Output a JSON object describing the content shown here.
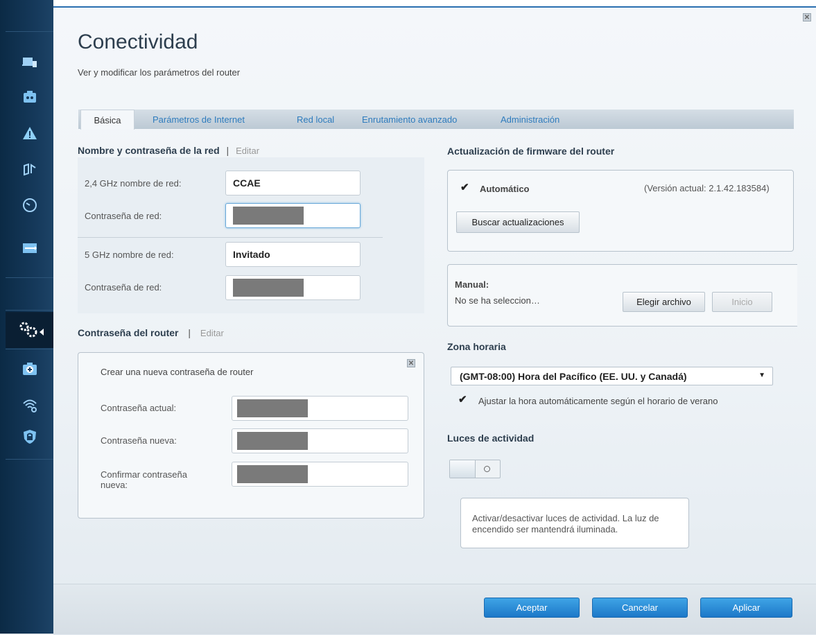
{
  "sidebar": {
    "icons": [
      "devices-icon",
      "parental-controls-icon",
      "warning-icon",
      "media-priority-icon",
      "speed-test-icon",
      "usb-storage-icon",
      "connectivity-icon",
      "troubleshooting-icon",
      "wireless-icon",
      "security-icon"
    ]
  },
  "header": {
    "title": "Conectividad",
    "subtitle": "Ver y modificar los parámetros del router"
  },
  "tabs": [
    {
      "label": "Básica"
    },
    {
      "label": "Parámetros de Internet"
    },
    {
      "label": "Red local"
    },
    {
      "label": "Enrutamiento avanzado"
    },
    {
      "label": "Administración"
    }
  ],
  "network": {
    "heading": "Nombre y contraseña de la red",
    "separator": "|",
    "edit": "Editar",
    "band24_label": "2,4 GHz nombre de red:",
    "band24_value": "CCAE",
    "password_label": "Contraseña de red:",
    "band5_label": "5 GHz nombre de red:",
    "band5_value": "Invitado",
    "password5_label": "Contraseña de red:"
  },
  "router_password": {
    "heading": "Contraseña del router",
    "separator": "|",
    "edit": "Editar",
    "box_title": "Crear una nueva contraseña de router",
    "current_label": "Contraseña actual:",
    "new_label": "Contraseña nueva:",
    "confirm_label": "Confirmar contraseña nueva:"
  },
  "firmware": {
    "heading": "Actualización de firmware del router",
    "auto_label": "Automático",
    "auto_checked": true,
    "version": "(Versión actual: 2.1.42.183584)",
    "check_button": "Buscar actualizaciones",
    "manual_label": "Manual:",
    "file_status": "No se ha seleccion…",
    "choose_file": "Elegir archivo",
    "start_button": "Inicio"
  },
  "timezone": {
    "heading": "Zona horaria",
    "selected": "(GMT-08:00) Hora del Pacífico (EE. UU. y Canadá)",
    "dst_label": "Ajustar la hora automáticamente según el horario de verano",
    "dst_checked": true
  },
  "lights": {
    "heading": "Luces de actividad",
    "toggle_state": "off",
    "description": "Activar/desactivar luces de actividad. La luz de encendido ser mantendrá iluminada."
  },
  "footer": {
    "ok": "Aceptar",
    "cancel": "Cancelar",
    "apply": "Aplicar"
  },
  "colors": {
    "sidebar": "#163a5c",
    "accent_blue": "#2e7bbd",
    "button_blue": "#1c78c8"
  }
}
